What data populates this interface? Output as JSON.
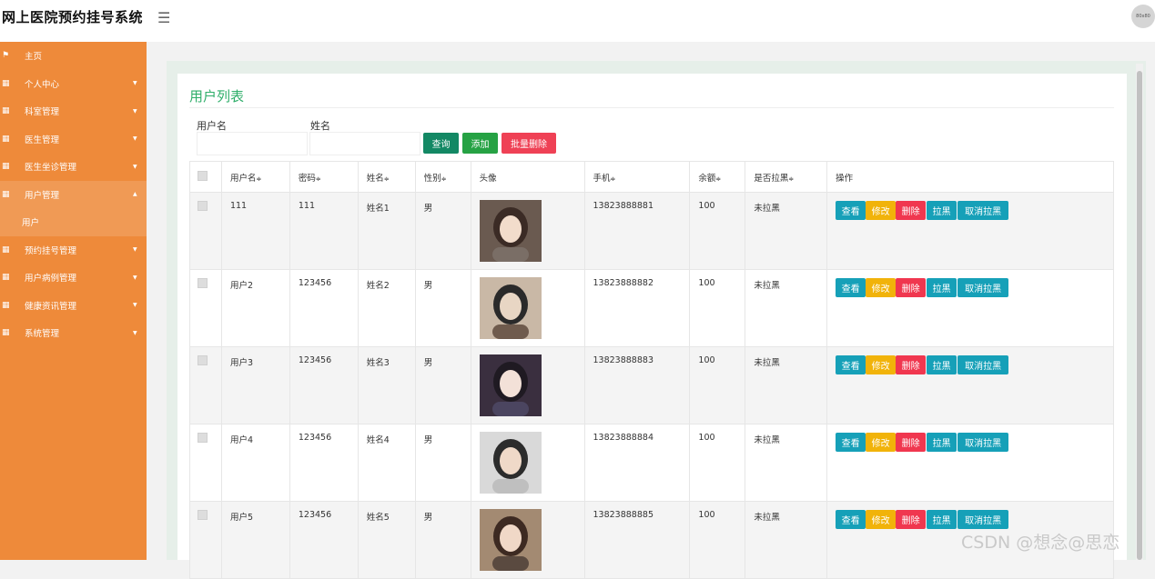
{
  "app": {
    "title": "网上医院预约挂号系统",
    "menu_icon": "hamburger-icon",
    "avatar_text": "80x80"
  },
  "sidebar": {
    "items": [
      {
        "label": "主页",
        "icon": "flag-icon",
        "caret": ""
      },
      {
        "label": "个人中心",
        "icon": "grid-icon",
        "caret": "▼"
      },
      {
        "label": "科室管理",
        "icon": "grid-icon",
        "caret": "▼"
      },
      {
        "label": "医生管理",
        "icon": "grid-icon",
        "caret": "▼"
      },
      {
        "label": "医生坐诊管理",
        "icon": "grid-icon",
        "caret": "▼"
      },
      {
        "label": "用户管理",
        "icon": "grid-icon",
        "caret": "▲"
      },
      {
        "label": "预约挂号管理",
        "icon": "grid-icon",
        "caret": "▼"
      },
      {
        "label": "用户病例管理",
        "icon": "grid-icon",
        "caret": "▼"
      },
      {
        "label": "健康资讯管理",
        "icon": "grid-icon",
        "caret": "▼"
      },
      {
        "label": "系统管理",
        "icon": "grid-icon",
        "caret": "▼"
      }
    ],
    "sub_item": "用户"
  },
  "panel": {
    "title": "用户列表"
  },
  "search": {
    "username_label": "用户名",
    "username_value": "",
    "name_label": "姓名",
    "name_value": "",
    "query_label": "查询",
    "add_label": "添加",
    "batch_delete_label": "批量删除"
  },
  "table": {
    "columns": [
      "",
      "用户名",
      "密码",
      "姓名",
      "性别",
      "头像",
      "手机",
      "余额",
      "是否拉黑",
      "操作"
    ],
    "sortable": [
      "用户名",
      "密码",
      "姓名",
      "性别",
      "手机",
      "余额",
      "是否拉黑"
    ],
    "rows": [
      {
        "username": "111",
        "password": "111",
        "name": "姓名1",
        "gender": "男",
        "phone": "13823888881",
        "balance": "100",
        "blacklisted": "未拉黑"
      },
      {
        "username": "用户2",
        "password": "123456",
        "name": "姓名2",
        "gender": "男",
        "phone": "13823888882",
        "balance": "100",
        "blacklisted": "未拉黑"
      },
      {
        "username": "用户3",
        "password": "123456",
        "name": "姓名3",
        "gender": "男",
        "phone": "13823888883",
        "balance": "100",
        "blacklisted": "未拉黑"
      },
      {
        "username": "用户4",
        "password": "123456",
        "name": "姓名4",
        "gender": "男",
        "phone": "13823888884",
        "balance": "100",
        "blacklisted": "未拉黑"
      },
      {
        "username": "用户5",
        "password": "123456",
        "name": "姓名5",
        "gender": "男",
        "phone": "13823888885",
        "balance": "100",
        "blacklisted": "未拉黑"
      }
    ],
    "actions": {
      "view": "查看",
      "edit": "修改",
      "delete": "删除",
      "blacklist": "拉黑",
      "unblacklist": "取消拉黑"
    },
    "sort_icon": "≑"
  },
  "watermark": "CSDN @想念@思恋"
}
